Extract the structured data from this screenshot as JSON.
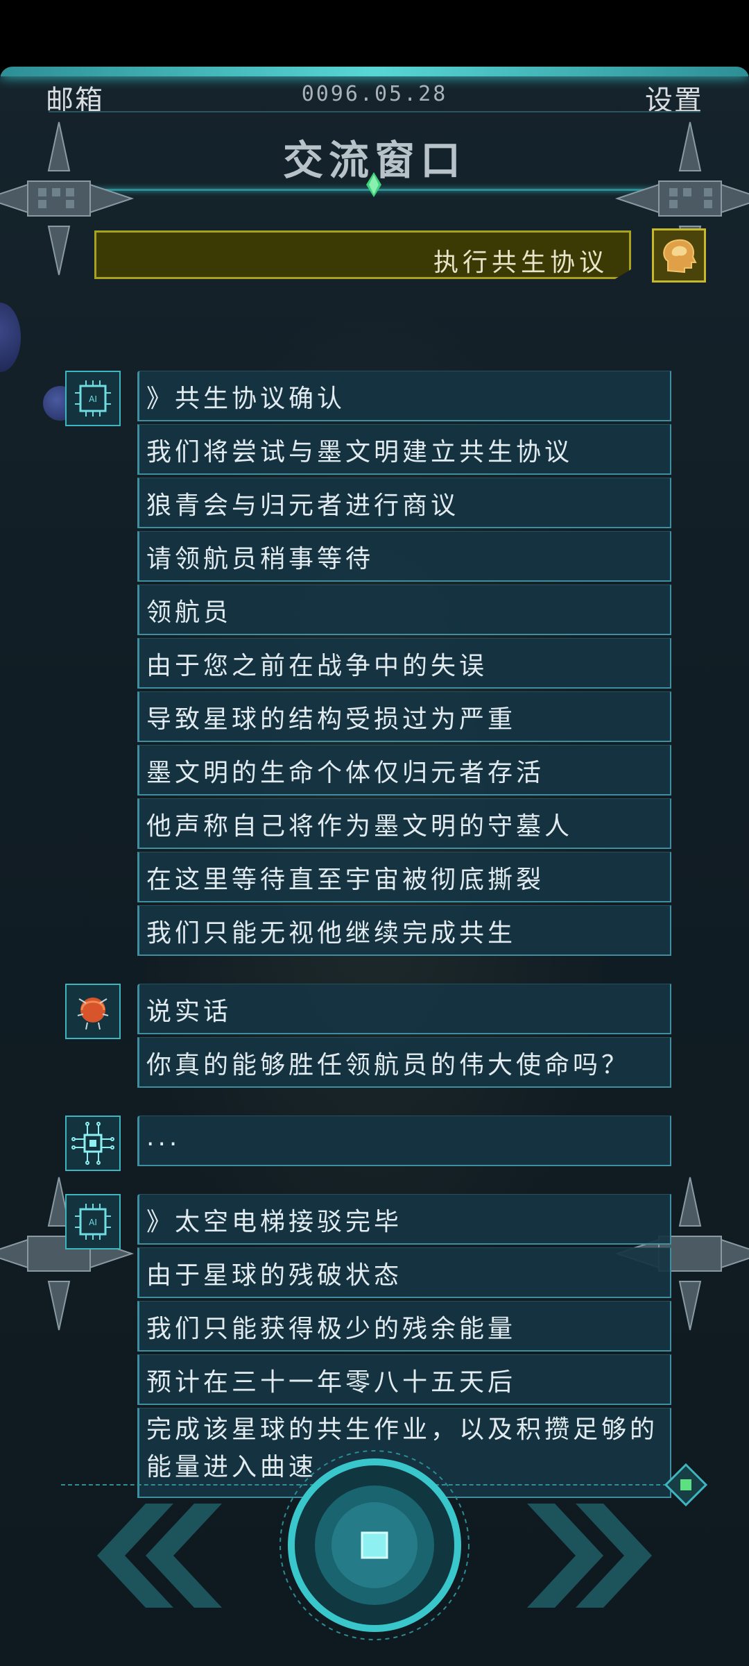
{
  "header": {
    "mail_label": "邮箱",
    "date": "0096.05.28",
    "settings_label": "设置",
    "title": "交流窗口"
  },
  "task": {
    "label": "执行共生协议"
  },
  "colors": {
    "accent": "#3fcfd4",
    "task_yellow": "#a8a21e",
    "panel": "#153442"
  },
  "conversation": [
    {
      "speaker_icon": "ai-chip-icon",
      "lines": [
        "》共生协议确认",
        "我们将尝试与墨文明建立共生协议",
        "狼青会与归元者进行商议",
        "请领航员稍事等待",
        "领航员",
        "由于您之前在战争中的失误",
        "导致星球的结构受损过为严重",
        "墨文明的生命个体仅归元者存活",
        "他声称自己将作为墨文明的守墓人",
        "在这里等待直至宇宙被彻底撕裂",
        "我们只能无视他继续完成共生"
      ]
    },
    {
      "speaker_icon": "red-brain-icon",
      "lines": [
        "说实话",
        "你真的能够胜任领航员的伟大使命吗？"
      ]
    },
    {
      "speaker_icon": "circuit-chip-icon",
      "lines": [
        "..."
      ]
    },
    {
      "speaker_icon": "ai-chip-icon",
      "lines": [
        "》太空电梯接驳完毕",
        "由于星球的残破状态",
        "我们只能获得极少的残余能量",
        "预计在三十一年零八十五天后",
        "完成该星球的共生作业，以及积攒足够",
        "的能量进入曲速"
      ]
    }
  ],
  "controls": {
    "back_icon": "double-chevron-left-icon",
    "forward_icon": "double-chevron-right-icon",
    "center_icon": "stop-icon"
  }
}
